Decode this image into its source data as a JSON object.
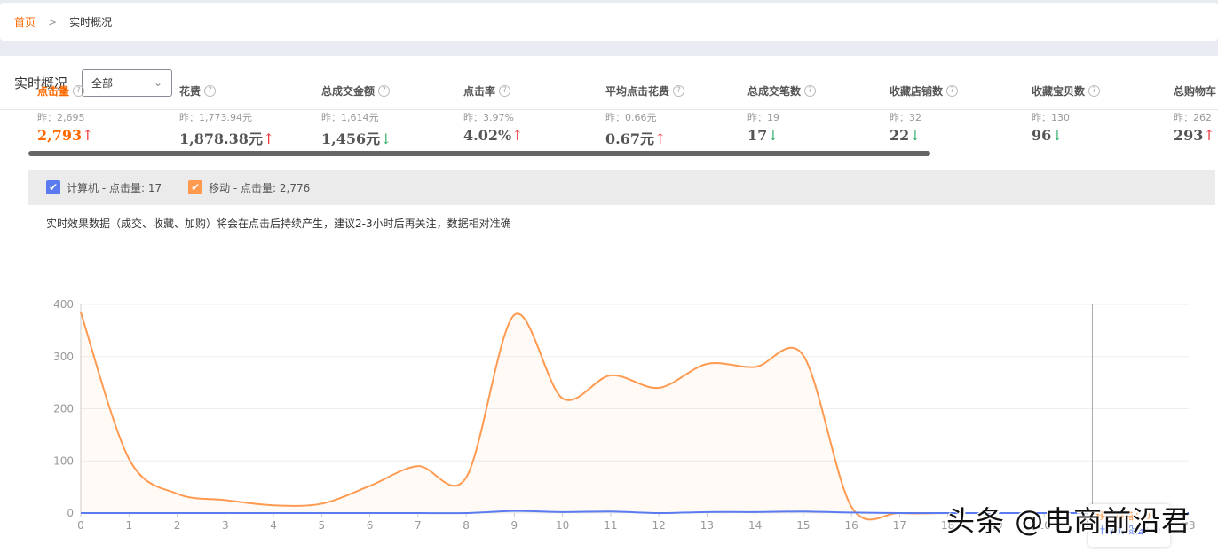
{
  "breadcrumb": {
    "home": "首页",
    "current": "实时概况"
  },
  "header": {
    "title": "实时概况",
    "select_value": "全部"
  },
  "metrics": [
    {
      "name": "点击量",
      "yesterday": "昨：2,695",
      "value": "2,793",
      "trend": "up",
      "active": true
    },
    {
      "name": "花费",
      "yesterday": "昨：1,773.94元",
      "value": "1,878.38元",
      "trend": "up"
    },
    {
      "name": "总成交金额",
      "yesterday": "昨：1,614元",
      "value": "1,456元",
      "trend": "down"
    },
    {
      "name": "点击率",
      "yesterday": "昨：3.97%",
      "value": "4.02%",
      "trend": "up"
    },
    {
      "name": "平均点击花费",
      "yesterday": "昨：0.66元",
      "value": "0.67元",
      "trend": "up"
    },
    {
      "name": "总成交笔数",
      "yesterday": "昨：19",
      "value": "17",
      "trend": "down"
    },
    {
      "name": "收藏店铺数",
      "yesterday": "昨：32",
      "value": "22",
      "trend": "down"
    },
    {
      "name": "收藏宝贝数",
      "yesterday": "昨：130",
      "value": "96",
      "trend": "down"
    },
    {
      "name": "总购物车",
      "yesterday": "昨：262",
      "value": "293",
      "trend": "up"
    }
  ],
  "legend": [
    {
      "label": "计算机 - 点击量: 17",
      "color": "#5b7cf0",
      "checked": true
    },
    {
      "label": "移动 - 点击量: 2,776",
      "color": "#ff9a50",
      "checked": true
    }
  ],
  "note": "实时效果数据（成交、收藏、加购）将会在点击后持续产生，建议2-3小时后再关注，数据相对准确",
  "tooltip": {
    "mobile": "移动设备：0",
    "pc": "计算机设备：0"
  },
  "watermark": "头条 @电商前沿君",
  "chart_data": {
    "type": "area",
    "x": [
      0,
      1,
      2,
      3,
      4,
      5,
      6,
      7,
      8,
      9,
      10,
      11,
      12,
      13,
      14,
      15,
      16,
      17,
      18,
      19,
      20,
      21,
      22,
      23
    ],
    "xlim": [
      0,
      23
    ],
    "ylim": [
      0,
      400
    ],
    "yticks": [
      0,
      100,
      200,
      300,
      400
    ],
    "grid": true,
    "highlight_x": 21,
    "series": [
      {
        "name": "移动",
        "color": "#ff9a50",
        "values": [
          385,
          104,
          37,
          25,
          15,
          18,
          52,
          90,
          68,
          380,
          220,
          264,
          240,
          286,
          280,
          302,
          12,
          0,
          0,
          0,
          0,
          0
        ]
      },
      {
        "name": "计算机",
        "color": "#5b7cf0",
        "values": [
          0,
          0,
          0,
          0,
          0,
          0,
          0,
          0,
          0,
          4,
          2,
          3,
          0,
          2,
          2,
          3,
          1,
          0,
          0,
          0,
          0,
          0
        ]
      }
    ]
  }
}
